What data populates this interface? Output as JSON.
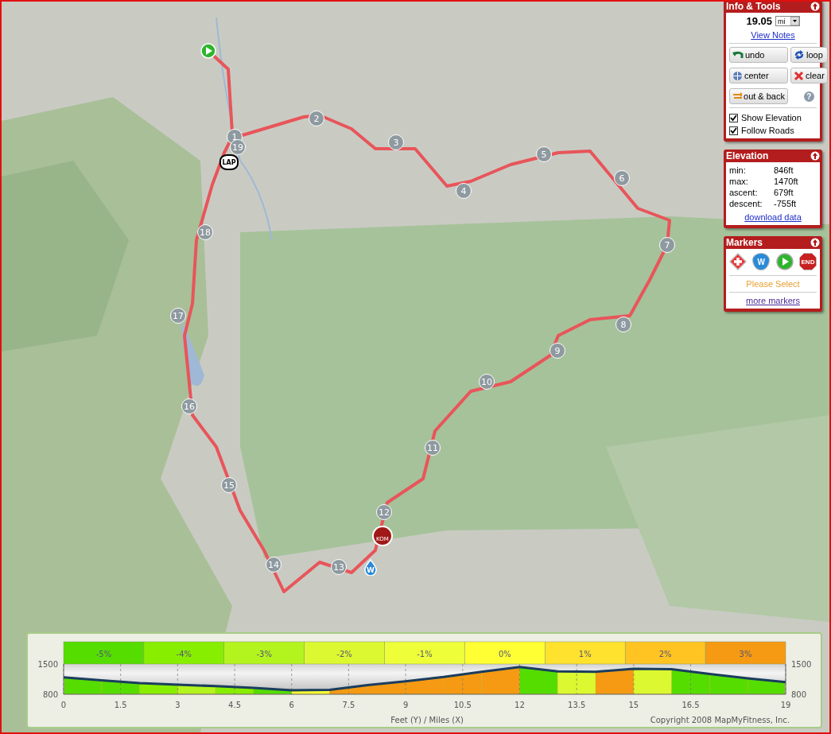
{
  "map": {
    "mile_markers": [
      "1",
      "2",
      "3",
      "4",
      "5",
      "6",
      "7",
      "8",
      "9",
      "10",
      "11",
      "12",
      "13",
      "14",
      "15",
      "16",
      "17",
      "18",
      "19"
    ],
    "special_markers": [
      {
        "kind": "start"
      },
      {
        "kind": "lap",
        "label": "LAP"
      },
      {
        "kind": "kom",
        "label": "KOM"
      },
      {
        "kind": "water",
        "label": "W"
      }
    ]
  },
  "info_tools": {
    "title": "Info & Tools",
    "distance": "19.05",
    "unit": "mi",
    "view_notes": "View Notes",
    "buttons": [
      {
        "kind": "undo",
        "label": "undo"
      },
      {
        "kind": "loop",
        "label": "loop"
      },
      {
        "kind": "center",
        "label": "center"
      },
      {
        "kind": "clear",
        "label": "clear"
      },
      {
        "kind": "out-back",
        "label": "out & back"
      }
    ],
    "help": "?",
    "checkboxes": [
      {
        "label": "Show Elevation",
        "checked": true
      },
      {
        "label": "Follow Roads",
        "checked": true
      }
    ]
  },
  "elevation": {
    "title": "Elevation",
    "stats": [
      {
        "label": "min:",
        "value": "846ft"
      },
      {
        "label": "max:",
        "value": "1470ft"
      },
      {
        "label": "ascent:",
        "value": "679ft"
      },
      {
        "label": "descent:",
        "value": "-755ft"
      }
    ],
    "download": "download data"
  },
  "markers": {
    "title": "Markers",
    "icons": [
      {
        "kind": "first-aid"
      },
      {
        "kind": "water",
        "label": "W"
      },
      {
        "kind": "start"
      },
      {
        "kind": "end",
        "label": "END"
      }
    ],
    "prompt": "Please Select",
    "more": "more markers"
  },
  "elevation_profile": {
    "grades": [
      {
        "label": "-5%",
        "color": "#55dd00"
      },
      {
        "label": "-4%",
        "color": "#88ee00"
      },
      {
        "label": "-3%",
        "color": "#b4f41e"
      },
      {
        "label": "-2%",
        "color": "#dcf830"
      },
      {
        "label": "-1%",
        "color": "#eeff3a"
      },
      {
        "label": "0%",
        "color": "#ffff33"
      },
      {
        "label": "1%",
        "color": "#ffe22e"
      },
      {
        "label": "2%",
        "color": "#ffc422"
      },
      {
        "label": "3%",
        "color": "#f59a12"
      }
    ],
    "right_axis_labels": [
      "1500",
      "800"
    ],
    "chart_data": {
      "type": "line",
      "grid": true,
      "xlabel": "Feet (Y) / Miles (X)",
      "x": [
        0,
        1,
        2,
        3,
        4,
        5,
        6,
        7,
        8,
        9,
        10,
        11,
        12,
        13,
        14,
        15,
        16,
        17,
        18,
        19
      ],
      "series": [
        {
          "color": "#1a3d5e",
          "values": [
            1190,
            1120,
            1060,
            1020,
            990,
            950,
            890,
            900,
            1010,
            1100,
            1200,
            1320,
            1430,
            1330,
            1320,
            1390,
            1380,
            1270,
            1170,
            1080
          ]
        }
      ],
      "xlim": [
        0,
        19
      ],
      "ylim": [
        800,
        1500
      ],
      "xticks": [
        0,
        1.5,
        3,
        4.5,
        6,
        7.5,
        9,
        10.5,
        12,
        13.5,
        15,
        16.5,
        19
      ],
      "yticks": [
        {
          "value": 800,
          "label": "800"
        },
        {
          "value": 1500,
          "label": "1500"
        }
      ]
    },
    "copyright": "Copyright 2008 MapMyFitness, Inc."
  }
}
